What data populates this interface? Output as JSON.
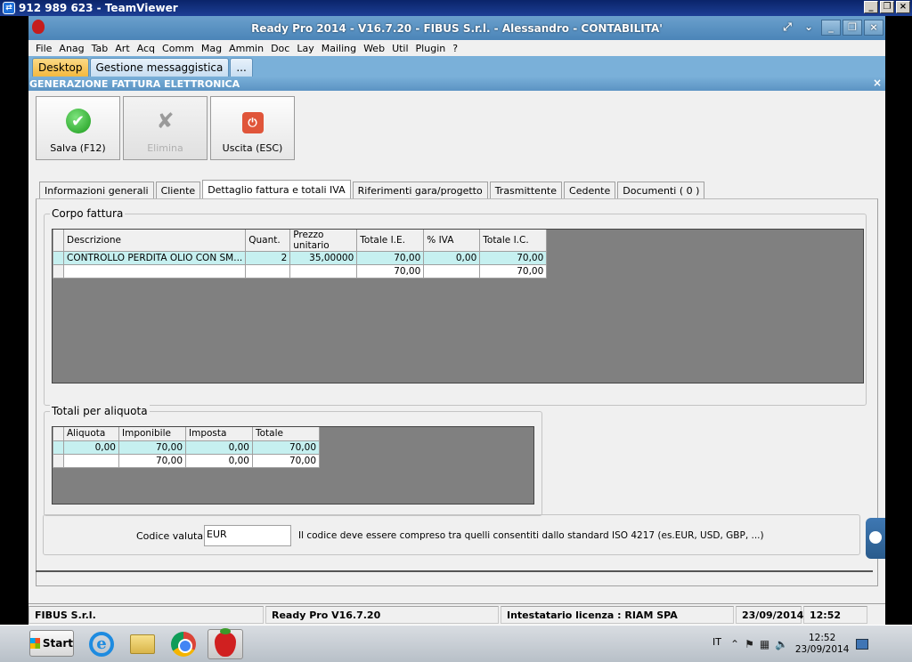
{
  "teamviewer": {
    "title": "912 989 623 - TeamViewer",
    "controls": [
      "_",
      "❐",
      "×"
    ]
  },
  "app": {
    "title": "Ready Pro 2014 - V16.7.20 - FIBUS S.r.l. - Alessandro - CONTABILITA'",
    "window_controls": [
      "_",
      "❐",
      "×"
    ],
    "extra_controls": [
      "⤢",
      "⌄"
    ]
  },
  "menu": [
    "File",
    "Anag",
    "Tab",
    "Art",
    "Acq",
    "Comm",
    "Mag",
    "Ammin",
    "Doc",
    "Lay",
    "Mailing",
    "Web",
    "Util",
    "Plugin",
    "?"
  ],
  "app_tabs": [
    "Desktop",
    "Gestione messaggistica",
    "..."
  ],
  "section_title": "GENERAZIONE FATTURA ELETTRONICA",
  "toolbar": {
    "save": "Salva (F12)",
    "delete": "Elimina",
    "exit": "Uscita (ESC)"
  },
  "tabs": [
    "Informazioni generali",
    "Cliente",
    "Dettaglio fattura e totali IVA",
    "Riferimenti gara/progetto",
    "Trasmittente",
    "Cedente",
    "Documenti ( 0 )"
  ],
  "corpo": {
    "title": "Corpo fattura",
    "headers": [
      "Descrizione",
      "Quant.",
      "Prezzo unitario",
      "Totale I.E.",
      "% IVA",
      "Totale I.C."
    ],
    "rows": [
      [
        "CONTROLLO PERDITA OLIO CON SM...",
        "2",
        "35,00000",
        "70,00",
        "0,00",
        "70,00"
      ],
      [
        "",
        "",
        "",
        "70,00",
        "",
        "70,00"
      ]
    ]
  },
  "totali": {
    "title": "Totali per aliquota",
    "headers": [
      "Aliquota",
      "Imponibile",
      "Imposta",
      "Totale"
    ],
    "rows": [
      [
        "0,00",
        "70,00",
        "0,00",
        "70,00"
      ],
      [
        "",
        "70,00",
        "0,00",
        "70,00"
      ]
    ]
  },
  "valuta": {
    "label": "Codice valuta :",
    "value": "EUR",
    "hint": "Il codice deve essere compreso tra quelli consentiti dallo standard ISO 4217 (es.EUR, USD, GBP, ...)"
  },
  "status": [
    "FIBUS S.r.l.",
    "Ready Pro V16.7.20",
    "Intestatario licenza : RIAM SPA",
    "23/09/2014",
    "12:52"
  ],
  "taskbar": {
    "start": "Start",
    "lang": "IT",
    "clock_time": "12:52",
    "clock_date": "23/09/2014",
    "tray_icons": [
      "chevron-up-icon",
      "flag-icon",
      "network-icon",
      "speaker-icon"
    ]
  }
}
